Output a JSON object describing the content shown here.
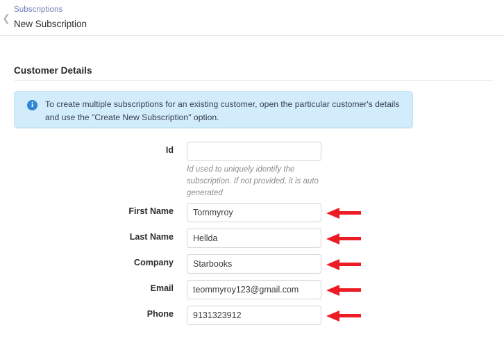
{
  "breadcrumb": {
    "back_icon": "chevron-left-icon",
    "parent_link": "Subscriptions",
    "current": "New Subscription"
  },
  "section": {
    "title": "Customer Details"
  },
  "info_banner": {
    "icon": "info-circle-icon",
    "text": "To create multiple subscriptions for an existing customer, open the particular customer's details and use the \"Create New Subscription\" option.",
    "background_color": "#d3ecfb",
    "icon_color": "#2f86d4"
  },
  "annotation": {
    "arrow_color": "#ed1c24",
    "icon": "arrow-left-icon"
  },
  "form": {
    "fields": [
      {
        "label": "Id",
        "value": "",
        "placeholder": "",
        "hint": "Id used to uniquely identify the subscription. If not provided, it is auto generated",
        "arrow": false
      },
      {
        "label": "First Name",
        "value": "Tommyroy",
        "placeholder": "",
        "hint": "",
        "arrow": true
      },
      {
        "label": "Last Name",
        "value": "Hellda",
        "placeholder": "",
        "hint": "",
        "arrow": true
      },
      {
        "label": "Company",
        "value": "Starbooks",
        "placeholder": "",
        "hint": "",
        "arrow": true
      },
      {
        "label": "Email",
        "value": "teommyroy123@gmail.com",
        "placeholder": "",
        "hint": "",
        "arrow": true
      },
      {
        "label": "Phone",
        "value": "9131323912",
        "placeholder": "",
        "hint": "",
        "arrow": true
      }
    ]
  }
}
